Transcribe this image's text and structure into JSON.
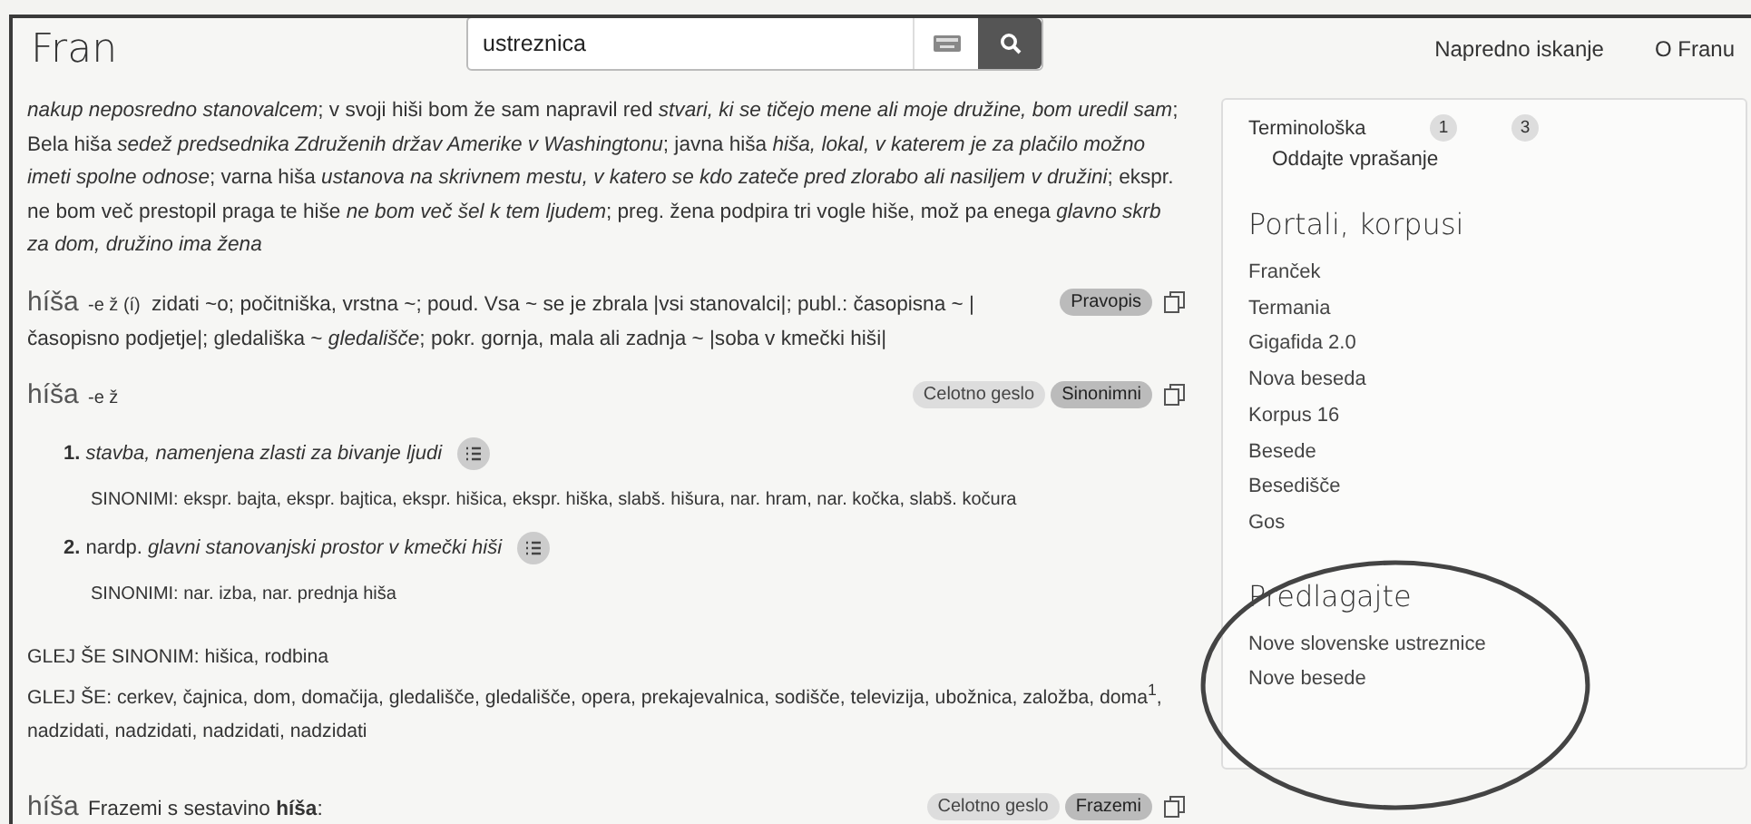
{
  "header": {
    "logo": "Fran",
    "search": {
      "value": "ustreznica"
    },
    "nav": [
      "Napredno iskanje",
      "O Franu"
    ]
  },
  "lead_text": "*nakup neposredno stanovalcem*; v svoji hiši bom že sam napravil red *stvari, ki se tičejo mene ali moje družine, bom uredil sam*; Bela hiša *sedež predsednika Združenih držav Amerike v Washingtonu*; javna hiša *hiša, lokal, v katerem je za plačilo možno imeti spolne odnose*; varna hiša *ustanova na skrivnem mestu, v katero se kdo zateče pred zlorabo ali nasiljem v družini*; ekspr. ne bom več prestopil praga te hiše *ne bom več šel k tem ljudem*; preg. žena podpira tri vogle hiše, mož pa enega *glavno skrb za dom, družino ima žena*",
  "entries": [
    {
      "kind": "plain",
      "headword": "híša",
      "grammar": "-e ž (í)",
      "body": "zidati ~o; počitniška, vrstna ~; poud. Vsa ~ se je zbrala |vsi stanovalci|; publ.: časopisna ~ |časopisno podjetje|; gledališka ~ *gledališče*; pokr. gornja, mala ali zadnja ~ |soba v kmečki hiši|",
      "tags": [
        {
          "label": "Pravopis",
          "selected": true
        }
      ]
    },
    {
      "kind": "senses",
      "headword": "híša",
      "grammar": "-e ž",
      "tags": [
        {
          "label": "Celotno geslo",
          "selected": false
        },
        {
          "label": "Sinonimni",
          "selected": true
        }
      ],
      "senses": [
        {
          "number": "1.",
          "definition": "*stavba, namenjena zlasti za bivanje ljudi*",
          "synonyms": "SINONIMI: ekspr. bajta, ekspr. bajtica, ekspr. hišica, ekspr. hiška, slabš. hišura, nar. hram, nar. kočka, slabš. kočura"
        },
        {
          "number": "2.",
          "definition": "nardp. *glavni stanovanjski prostor v kmečki hiši*",
          "synonyms": "SINONIMI: nar. izba, nar. prednja hiša"
        }
      ],
      "see_also": [
        "GLEJ ŠE SINONIM: hišica, rodbina",
        "GLEJ ŠE: cerkev, čajnica, dom, domačija, gledališče, gledališče, opera, prekajevalnica, sodišče, televizija, ubožnica, založba, doma$^{1}$, nadzidati, nadzidati, nadzidati, nadzidati"
      ]
    },
    {
      "kind": "phrases",
      "headword": "híša",
      "body": "Frazemi s sestavino **híša**:",
      "tags": [
        {
          "label": "Celotno geslo",
          "selected": false
        },
        {
          "label": "Frazemi",
          "selected": true
        }
      ]
    }
  ],
  "sidebar": {
    "term_row": {
      "label": "Terminološka",
      "counts": [
        "1",
        "3"
      ]
    },
    "term_link": "Oddajte vprašanje",
    "sections": [
      {
        "title": "Portali, korpusi",
        "items": [
          "Franček",
          "Termania",
          "Gigafida 2.0",
          "Nova beseda",
          "Korpus 16",
          "Besede",
          "Besedišče",
          "Gos"
        ]
      },
      {
        "title": "Predlagajte",
        "items": [
          "Nove slovenske ustreznice",
          "Nove besede"
        ],
        "circled": true
      }
    ]
  }
}
